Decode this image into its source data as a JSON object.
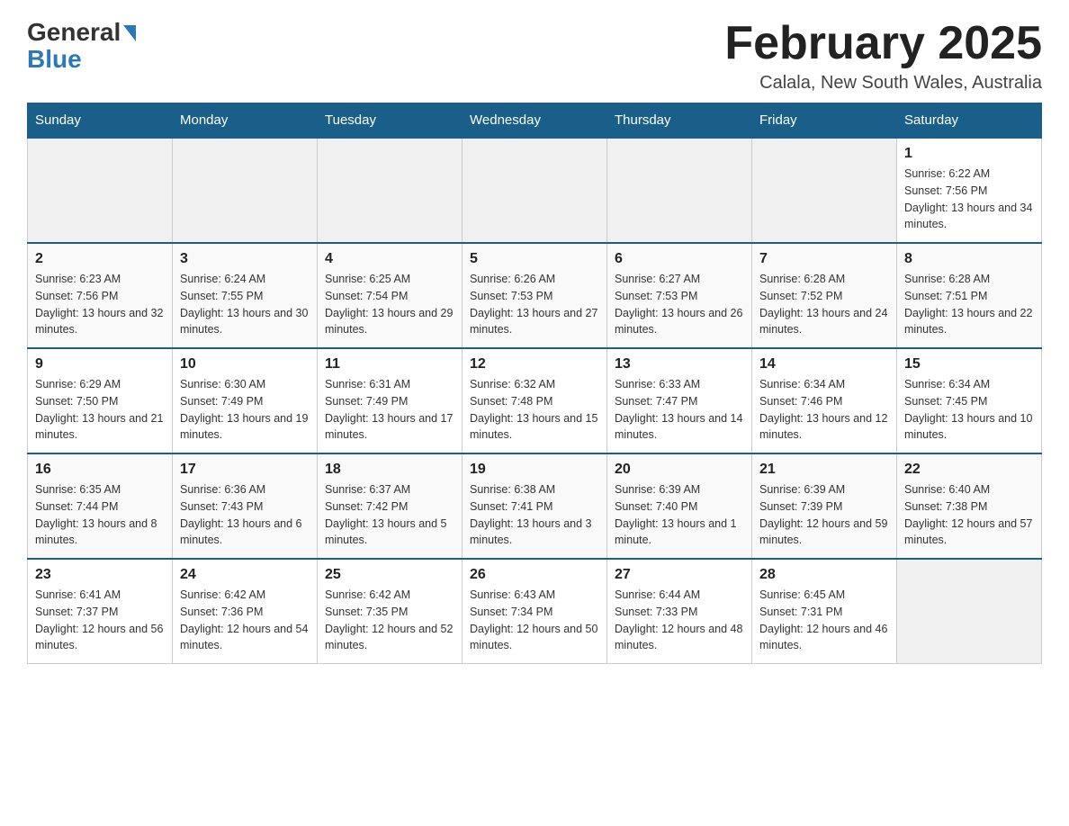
{
  "header": {
    "logo_general": "General",
    "logo_blue": "Blue",
    "title": "February 2025",
    "location": "Calala, New South Wales, Australia"
  },
  "days_of_week": [
    "Sunday",
    "Monday",
    "Tuesday",
    "Wednesday",
    "Thursday",
    "Friday",
    "Saturday"
  ],
  "weeks": [
    [
      {
        "day": "",
        "info": ""
      },
      {
        "day": "",
        "info": ""
      },
      {
        "day": "",
        "info": ""
      },
      {
        "day": "",
        "info": ""
      },
      {
        "day": "",
        "info": ""
      },
      {
        "day": "",
        "info": ""
      },
      {
        "day": "1",
        "info": "Sunrise: 6:22 AM\nSunset: 7:56 PM\nDaylight: 13 hours and 34 minutes."
      }
    ],
    [
      {
        "day": "2",
        "info": "Sunrise: 6:23 AM\nSunset: 7:56 PM\nDaylight: 13 hours and 32 minutes."
      },
      {
        "day": "3",
        "info": "Sunrise: 6:24 AM\nSunset: 7:55 PM\nDaylight: 13 hours and 30 minutes."
      },
      {
        "day": "4",
        "info": "Sunrise: 6:25 AM\nSunset: 7:54 PM\nDaylight: 13 hours and 29 minutes."
      },
      {
        "day": "5",
        "info": "Sunrise: 6:26 AM\nSunset: 7:53 PM\nDaylight: 13 hours and 27 minutes."
      },
      {
        "day": "6",
        "info": "Sunrise: 6:27 AM\nSunset: 7:53 PM\nDaylight: 13 hours and 26 minutes."
      },
      {
        "day": "7",
        "info": "Sunrise: 6:28 AM\nSunset: 7:52 PM\nDaylight: 13 hours and 24 minutes."
      },
      {
        "day": "8",
        "info": "Sunrise: 6:28 AM\nSunset: 7:51 PM\nDaylight: 13 hours and 22 minutes."
      }
    ],
    [
      {
        "day": "9",
        "info": "Sunrise: 6:29 AM\nSunset: 7:50 PM\nDaylight: 13 hours and 21 minutes."
      },
      {
        "day": "10",
        "info": "Sunrise: 6:30 AM\nSunset: 7:49 PM\nDaylight: 13 hours and 19 minutes."
      },
      {
        "day": "11",
        "info": "Sunrise: 6:31 AM\nSunset: 7:49 PM\nDaylight: 13 hours and 17 minutes."
      },
      {
        "day": "12",
        "info": "Sunrise: 6:32 AM\nSunset: 7:48 PM\nDaylight: 13 hours and 15 minutes."
      },
      {
        "day": "13",
        "info": "Sunrise: 6:33 AM\nSunset: 7:47 PM\nDaylight: 13 hours and 14 minutes."
      },
      {
        "day": "14",
        "info": "Sunrise: 6:34 AM\nSunset: 7:46 PM\nDaylight: 13 hours and 12 minutes."
      },
      {
        "day": "15",
        "info": "Sunrise: 6:34 AM\nSunset: 7:45 PM\nDaylight: 13 hours and 10 minutes."
      }
    ],
    [
      {
        "day": "16",
        "info": "Sunrise: 6:35 AM\nSunset: 7:44 PM\nDaylight: 13 hours and 8 minutes."
      },
      {
        "day": "17",
        "info": "Sunrise: 6:36 AM\nSunset: 7:43 PM\nDaylight: 13 hours and 6 minutes."
      },
      {
        "day": "18",
        "info": "Sunrise: 6:37 AM\nSunset: 7:42 PM\nDaylight: 13 hours and 5 minutes."
      },
      {
        "day": "19",
        "info": "Sunrise: 6:38 AM\nSunset: 7:41 PM\nDaylight: 13 hours and 3 minutes."
      },
      {
        "day": "20",
        "info": "Sunrise: 6:39 AM\nSunset: 7:40 PM\nDaylight: 13 hours and 1 minute."
      },
      {
        "day": "21",
        "info": "Sunrise: 6:39 AM\nSunset: 7:39 PM\nDaylight: 12 hours and 59 minutes."
      },
      {
        "day": "22",
        "info": "Sunrise: 6:40 AM\nSunset: 7:38 PM\nDaylight: 12 hours and 57 minutes."
      }
    ],
    [
      {
        "day": "23",
        "info": "Sunrise: 6:41 AM\nSunset: 7:37 PM\nDaylight: 12 hours and 56 minutes."
      },
      {
        "day": "24",
        "info": "Sunrise: 6:42 AM\nSunset: 7:36 PM\nDaylight: 12 hours and 54 minutes."
      },
      {
        "day": "25",
        "info": "Sunrise: 6:42 AM\nSunset: 7:35 PM\nDaylight: 12 hours and 52 minutes."
      },
      {
        "day": "26",
        "info": "Sunrise: 6:43 AM\nSunset: 7:34 PM\nDaylight: 12 hours and 50 minutes."
      },
      {
        "day": "27",
        "info": "Sunrise: 6:44 AM\nSunset: 7:33 PM\nDaylight: 12 hours and 48 minutes."
      },
      {
        "day": "28",
        "info": "Sunrise: 6:45 AM\nSunset: 7:31 PM\nDaylight: 12 hours and 46 minutes."
      },
      {
        "day": "",
        "info": ""
      }
    ]
  ]
}
